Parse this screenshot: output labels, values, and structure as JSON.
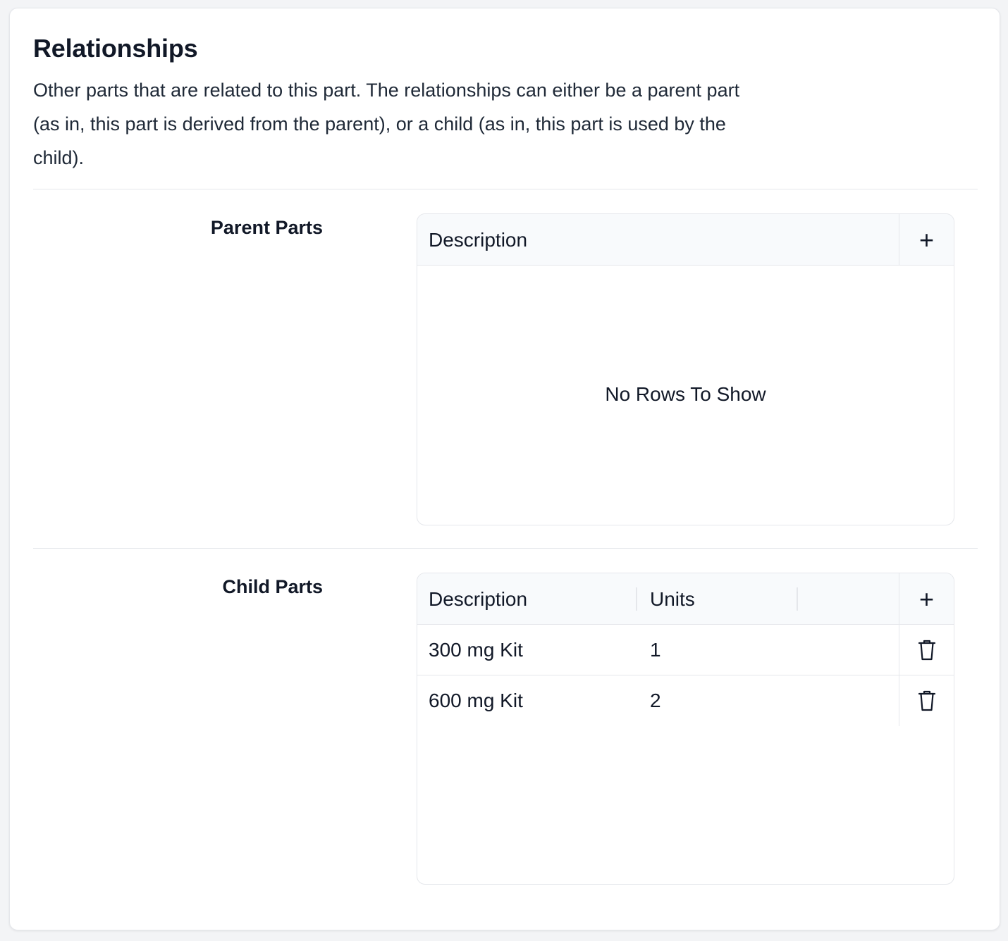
{
  "section": {
    "title": "Relationships",
    "description": "Other parts that are related to this part. The relationships can either be a parent part (as in, this part is derived from the parent), or a child (as in, this part is used by the child)."
  },
  "parent_parts": {
    "label": "Parent Parts",
    "columns": [
      "Description"
    ],
    "add_icon": "plus-icon",
    "empty_message": "No Rows To Show"
  },
  "child_parts": {
    "label": "Child Parts",
    "columns": [
      "Description",
      "Units"
    ],
    "add_icon": "plus-icon",
    "delete_icon": "trash-icon",
    "rows": [
      {
        "description": "300 mg Kit",
        "units": "1"
      },
      {
        "description": "600 mg Kit",
        "units": "2"
      }
    ]
  },
  "colors": {
    "text": "#111827",
    "border": "#e5e7eb",
    "header_bg": "#f8fafc"
  }
}
